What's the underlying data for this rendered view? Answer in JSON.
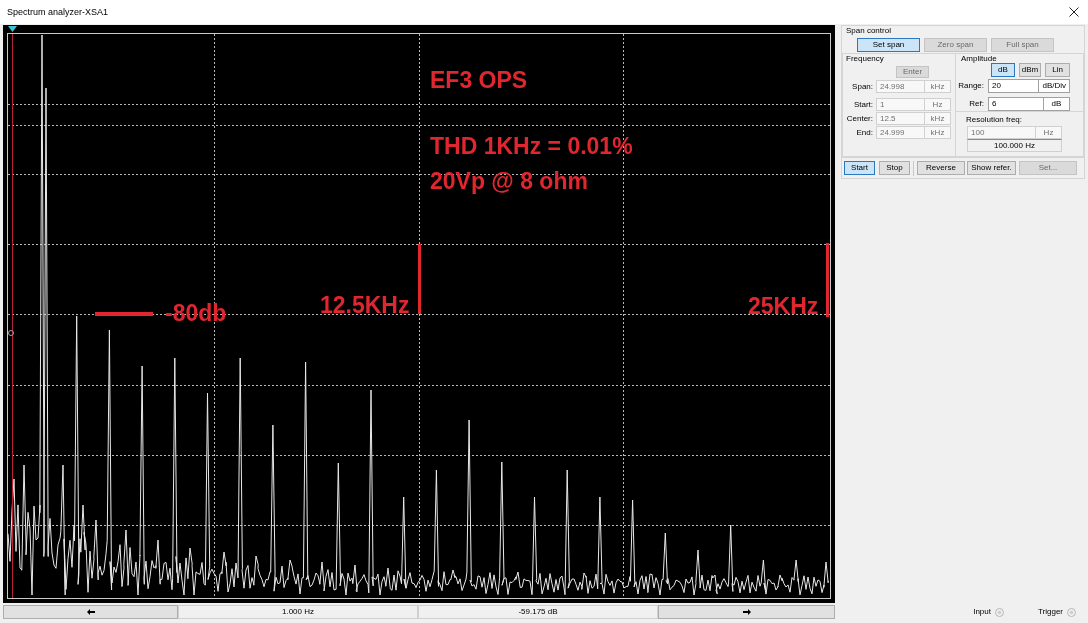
{
  "window": {
    "title": "Spectrum analyzer-XSA1"
  },
  "display": {
    "annotations": [
      {
        "kind": "label",
        "text": "EF3 OPS"
      },
      {
        "kind": "label",
        "text": "THD 1KHz = 0.01%"
      },
      {
        "kind": "label",
        "text": "20Vp @ 8 ohm"
      },
      {
        "kind": "h-marker",
        "text": "-80db"
      },
      {
        "kind": "v-marker",
        "text": "12.5KHz"
      },
      {
        "kind": "v-marker",
        "text": "25KHz"
      }
    ]
  },
  "readout_bar": {
    "frequency": "1.000 Hz",
    "level": "-59.175 dB"
  },
  "span_control": {
    "title": "Span control",
    "span_buttons": [
      {
        "label": "Set span",
        "selected": true,
        "disabled": false
      },
      {
        "label": "Zero span",
        "selected": false,
        "disabled": true
      },
      {
        "label": "Full span",
        "selected": false,
        "disabled": true
      }
    ],
    "frequency": {
      "title": "Frequency",
      "enter_button": {
        "label": "Enter",
        "disabled": true
      },
      "fields": [
        {
          "label": "Span:",
          "value": "24.998",
          "unit": "kHz",
          "disabled": true
        },
        {
          "label": "Start:",
          "value": "1",
          "unit": "Hz",
          "disabled": true
        },
        {
          "label": "Center:",
          "value": "12.5",
          "unit": "kHz",
          "disabled": true
        },
        {
          "label": "End:",
          "value": "24.999",
          "unit": "kHz",
          "disabled": true
        }
      ]
    },
    "amplitude": {
      "title": "Amplitude",
      "scale_buttons": [
        {
          "label": "dB",
          "selected": true
        },
        {
          "label": "dBm",
          "selected": false
        },
        {
          "label": "Lin",
          "selected": false
        }
      ],
      "fields": [
        {
          "label": "Range:",
          "value": "20",
          "unit": "dB/Div",
          "disabled": false
        },
        {
          "label": "Ref:",
          "value": "6",
          "unit": "dB",
          "disabled": false
        }
      ]
    },
    "resolution": {
      "title": "Resolution freq:",
      "value": "100",
      "unit": "Hz",
      "disabled": true,
      "readout": "100.000 Hz"
    },
    "actions": [
      {
        "label": "Start",
        "selected": true,
        "disabled": false
      },
      {
        "label": "Stop",
        "selected": false,
        "disabled": false
      },
      {
        "label": "Reverse",
        "selected": false,
        "disabled": false
      },
      {
        "label": "Show refer.",
        "selected": false,
        "disabled": false
      },
      {
        "label": "Set...",
        "selected": false,
        "disabled": true
      }
    ]
  },
  "terminals": [
    {
      "label": "Input"
    },
    {
      "label": "Trigger"
    }
  ]
}
